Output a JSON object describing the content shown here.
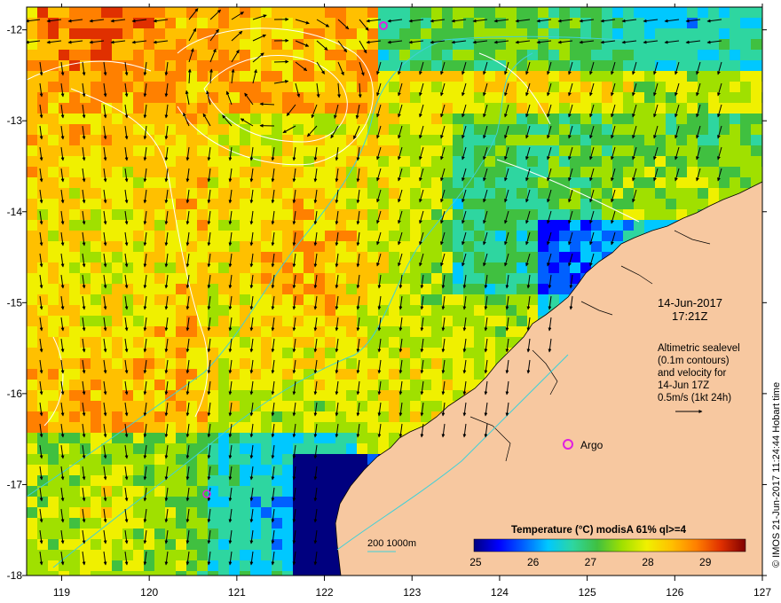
{
  "map": {
    "date": "14-Jun-2017",
    "time": "17:21Z",
    "altimetry_lines": [
      "Altimetric sealevel",
      "(0.1m contours)",
      "and velocity for",
      "14-Jun 17Z",
      "0.5m/s (1kt 24h)"
    ],
    "argo_label": "Argo",
    "depth_legend": "200  1000m",
    "credit": "© IMOS 21-Jun-2017 11:24:44 Hobart time",
    "lon_ticks": [
      "119",
      "120",
      "121",
      "122",
      "123",
      "124",
      "125",
      "126",
      "127"
    ],
    "lat_ticks": [
      "-12",
      "-13",
      "-14",
      "-15",
      "-16",
      "-17",
      "-18"
    ]
  },
  "colorbar": {
    "title": "Temperature (°C) modisA 61% ql>=4",
    "ticks": [
      "25",
      "26",
      "27",
      "28",
      "29"
    ],
    "range": [
      24.97,
      29.7
    ],
    "colors": [
      "#00007f",
      "#0000ff",
      "#0060ff",
      "#00c8ff",
      "#2ed6a0",
      "#40c040",
      "#a0e000",
      "#f0f000",
      "#ffc000",
      "#ff8000",
      "#e03000",
      "#800000"
    ]
  },
  "colors": {
    "land": "#f7c8a0",
    "velocity_arrow": "#000000",
    "sealevel_contour": "#ffffff",
    "bathymetry": "#40d0d8",
    "argo_marker": "#e020e0"
  }
}
